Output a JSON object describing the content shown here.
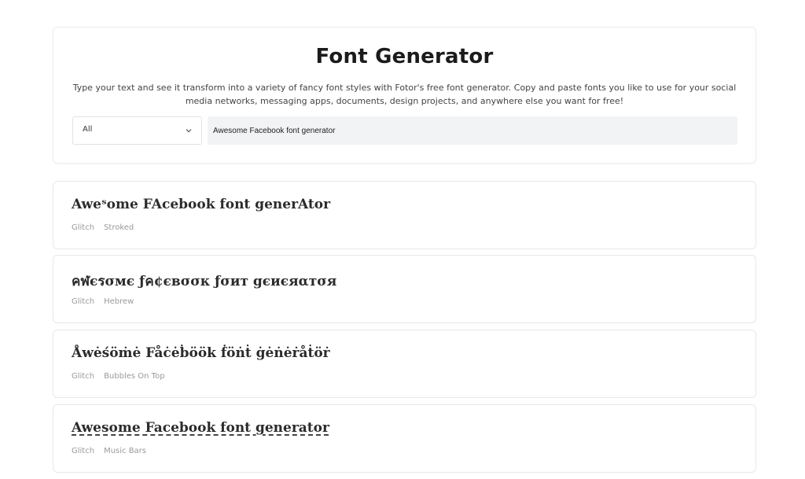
{
  "header": {
    "title": "Font Generator",
    "description": "Type your text and see it transform into a variety of fancy font styles with Fotor's free font generator. Copy and paste fonts you like to use for your social media networks, messaging apps, documents, design projects, and anywhere else you want for free!"
  },
  "controls": {
    "category_selected": "All",
    "input_value": "Awesome Facebook font generator",
    "chevron_icon": "chevron-down-icon"
  },
  "results": [
    {
      "text": "Aweˢome FAcebook font generAtor",
      "tags": [
        "Glitch",
        "Stroked"
      ]
    },
    {
      "text": "คฬєรσмє ƒค¢євσσк ƒσит gєиєяαтσя",
      "tags": [
        "Glitch",
        "Hebrew"
      ]
    },
    {
      "text": "Åwėśöṁė Fåċėḃöök ḟöṅṫ ġėṅėṙåṫöṙ",
      "tags": [
        "Glitch",
        "Bubbles On Top"
      ]
    },
    {
      "text": "Awesome Facebook font generator",
      "tags": [
        "Glitch",
        "Music Bars"
      ]
    }
  ]
}
